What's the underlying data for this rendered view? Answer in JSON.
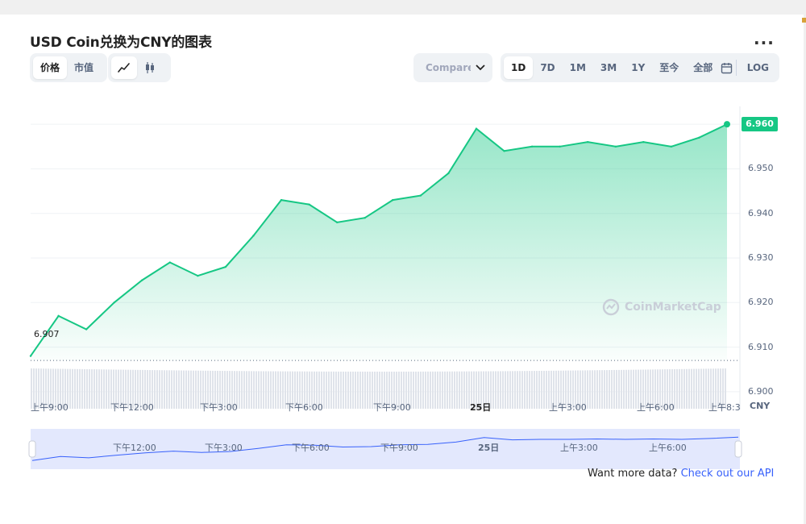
{
  "title": "USD Coin兑换为CNY的图表",
  "more_label": "...",
  "toggle": {
    "price": "价格",
    "marketcap": "市值"
  },
  "chart_icons": {
    "line": "line-chart-icon",
    "candle": "candlestick-icon"
  },
  "compare_label": "Compare with",
  "ranges": [
    "1D",
    "7D",
    "1M",
    "3M",
    "1Y",
    "至今",
    "全部"
  ],
  "active_range": "1D",
  "calendar_icon": "calendar-icon",
  "log_label": "LOG",
  "watermark": "CoinMarketCap",
  "currency_label": "CNY",
  "current_price": "6.960",
  "start_price": "6.907",
  "y_ticks": [
    "6.960",
    "6.950",
    "6.940",
    "6.930",
    "6.920",
    "6.910",
    "6.900"
  ],
  "x_ticks": [
    {
      "label": "上午9:00",
      "bold": false
    },
    {
      "label": "下午12:00",
      "bold": false
    },
    {
      "label": "下午3:00",
      "bold": false
    },
    {
      "label": "下午6:00",
      "bold": false
    },
    {
      "label": "下午9:00",
      "bold": false
    },
    {
      "label": "25日",
      "bold": true
    },
    {
      "label": "上午3:00",
      "bold": false
    },
    {
      "label": "上午6:00",
      "bold": false
    },
    {
      "label": "上午8:3",
      "bold": false
    }
  ],
  "nav_ticks": [
    {
      "label": "下午12:00",
      "bold": false
    },
    {
      "label": "下午3:00",
      "bold": false
    },
    {
      "label": "下午6:00",
      "bold": false
    },
    {
      "label": "下午9:00",
      "bold": false
    },
    {
      "label": "25日",
      "bold": true
    },
    {
      "label": "上午3:00",
      "bold": false
    },
    {
      "label": "上午6:00",
      "bold": false
    }
  ],
  "footer": {
    "text": "Want more data?",
    "link": "Check out our API"
  },
  "colors": {
    "line": "#16c784",
    "accent": "#3861fb",
    "muted": "#58667e"
  },
  "chart_data": {
    "type": "area",
    "title": "USD Coin兑换为CNY的图表",
    "xlabel": "",
    "ylabel": "CNY",
    "ylim": [
      6.896,
      6.964
    ],
    "grid": true,
    "x": [
      "上午8:30",
      "上午9:00",
      "上午10:00",
      "上午11:00",
      "下午12:00",
      "下午1:00",
      "下午2:00",
      "下午3:00",
      "下午4:00",
      "下午5:00",
      "下午6:00",
      "下午7:00",
      "下午8:00",
      "下午9:00",
      "下午10:00",
      "下午11:00",
      "25日",
      "上午1:00",
      "上午2:00",
      "上午3:00",
      "上午4:00",
      "上午5:00",
      "上午6:00",
      "上午7:00",
      "上午8:00",
      "上午8:30"
    ],
    "values": [
      6.908,
      6.917,
      6.914,
      6.92,
      6.925,
      6.929,
      6.926,
      6.928,
      6.935,
      6.943,
      6.942,
      6.938,
      6.939,
      6.943,
      6.944,
      6.949,
      6.959,
      6.954,
      6.955,
      6.955,
      6.956,
      6.955,
      6.956,
      6.955,
      6.957,
      6.96
    ]
  }
}
